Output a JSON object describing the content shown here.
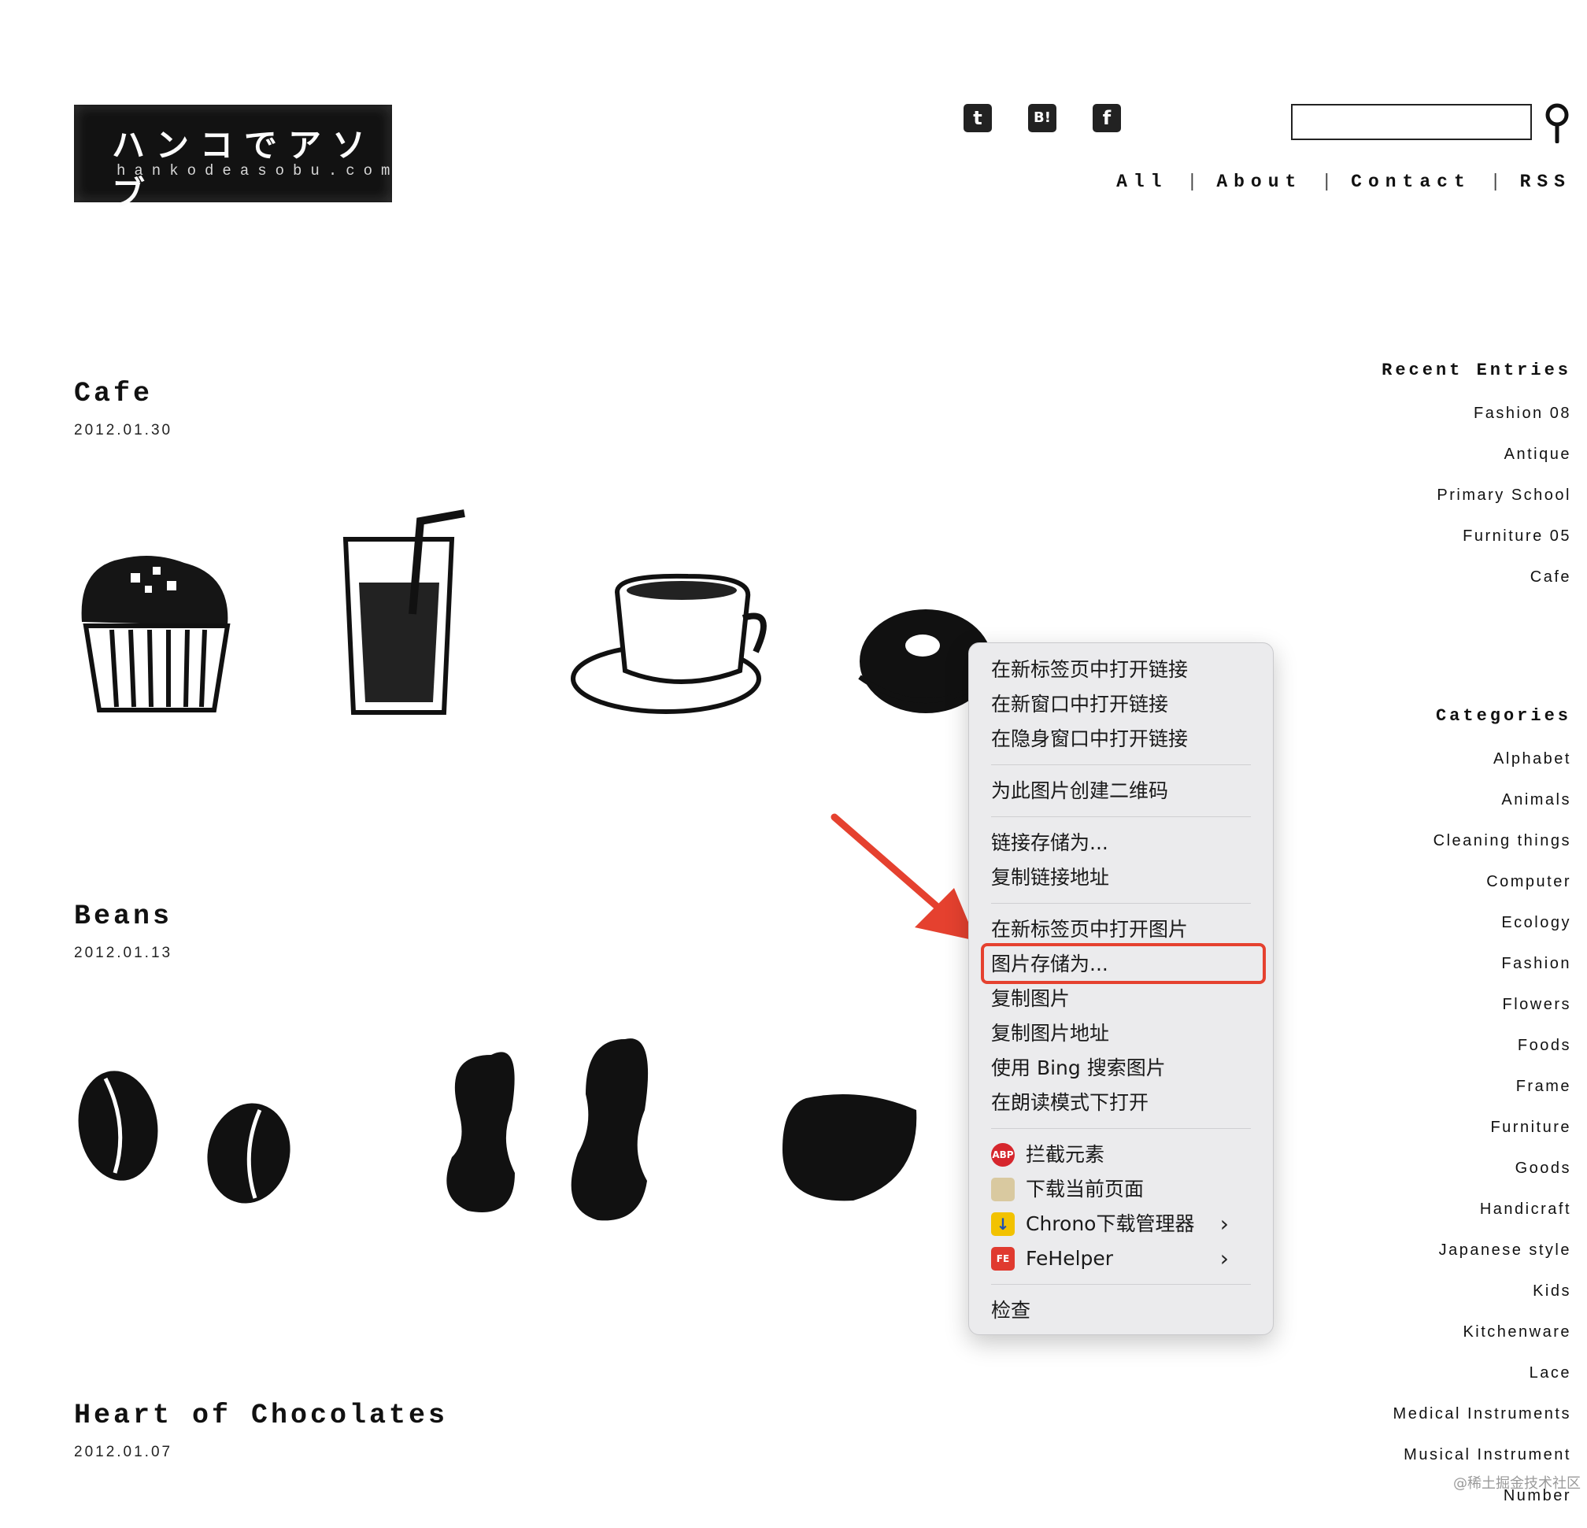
{
  "logo": {
    "title": "ハンコでアソブ",
    "domain": "hankodeasobu.com"
  },
  "social": [
    {
      "name": "twitter",
      "glyph": "t"
    },
    {
      "name": "hatena-bookmark",
      "glyph": "B!"
    },
    {
      "name": "facebook",
      "glyph": "f"
    }
  ],
  "search": {
    "placeholder": ""
  },
  "nav": {
    "items": [
      "All",
      "About",
      "Contact",
      "RSS"
    ],
    "separator": "|"
  },
  "posts": [
    {
      "title": "Cafe",
      "date": "2012.01.30"
    },
    {
      "title": "Beans",
      "date": "2012.01.13"
    },
    {
      "title": "Heart of Chocolates",
      "date": "2012.01.07"
    }
  ],
  "sidebar": {
    "recent_heading": "Recent Entries",
    "recent": [
      "Fashion 08",
      "Antique",
      "Primary School",
      "Furniture 05",
      "Cafe"
    ],
    "categories_heading": "Categories",
    "categories": [
      "Alphabet",
      "Animals",
      "Cleaning things",
      "Computer",
      "Ecology",
      "Fashion",
      "Flowers",
      "Foods",
      "Frame",
      "Furniture",
      "Goods",
      "Handicraft",
      "Japanese style",
      "Kids",
      "Kitchenware",
      "Lace",
      "Medical Instruments",
      "Musical Instrument",
      "Number"
    ]
  },
  "context_menu": {
    "open_link_new_tab": "在新标签页中打开链接",
    "open_link_new_window": "在新窗口中打开链接",
    "open_link_incognito": "在隐身窗口中打开链接",
    "create_qr": "为此图片创建二维码",
    "save_link_as": "链接存储为...",
    "copy_link_address": "复制链接地址",
    "open_image_new_tab": "在新标签页中打开图片",
    "save_image_as": "图片存储为...",
    "copy_image": "复制图片",
    "copy_image_address": "复制图片地址",
    "search_image_bing": "使用 Bing 搜索图片",
    "open_reader_mode": "在朗读模式下打开",
    "block_element": "拦截元素",
    "download_page": "下载当前页面",
    "chrono": "Chrono下载管理器",
    "fehelper": "FeHelper",
    "inspect": "检查",
    "abp_icon": "ABP",
    "fe_icon": "FE",
    "submenu_arrow": "›"
  },
  "colors": {
    "highlight": "#e5412f",
    "menu_bg": "#ebebed"
  },
  "watermark": "@稀土掘金技术社区"
}
